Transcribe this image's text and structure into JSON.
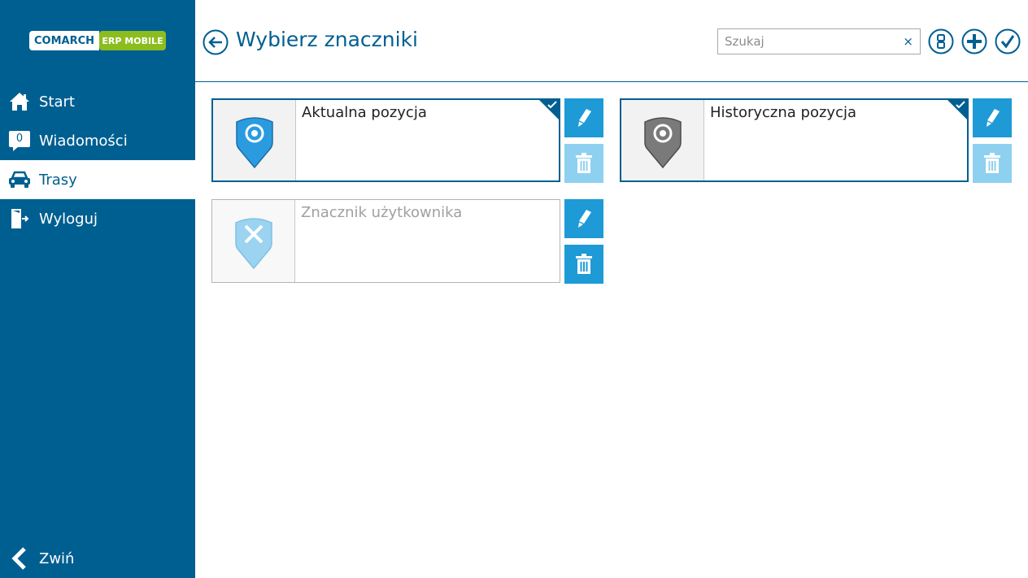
{
  "app": {
    "logo_left": "COMARCH",
    "logo_right": "ERP MOBILE",
    "colors": {
      "sidebar": "#005f91",
      "accent": "#1e9ad6",
      "accent_disabled": "#8ed0ef",
      "logo_green": "#8cbd1f"
    }
  },
  "sidebar": {
    "items": [
      {
        "label": "Start",
        "icon": "home-icon"
      },
      {
        "label": "Wiadomości",
        "icon": "message-icon",
        "badge": "0"
      },
      {
        "label": "Trasy",
        "icon": "car-icon",
        "active": true
      },
      {
        "label": "Wyloguj",
        "icon": "logout-icon"
      }
    ],
    "collapse_label": "Zwiń"
  },
  "header": {
    "title": "Wybierz znaczniki",
    "search_placeholder": "Szukaj",
    "search_value": "",
    "clear_symbol": "×"
  },
  "markers": [
    {
      "name": "Aktualna pozycja",
      "icon": "location-pin-icon",
      "pin_color": "#2b9be0",
      "selected": true,
      "delete_enabled": false
    },
    {
      "name": "Historyczna pozycja",
      "icon": "location-pin-icon",
      "pin_color": "#7a7a7a",
      "selected": true,
      "delete_enabled": false
    },
    {
      "name": "Znacznik użytkownika",
      "icon": "cross-pin-icon",
      "pin_color": "#9bd3f0",
      "selected": false,
      "delete_enabled": true
    }
  ]
}
